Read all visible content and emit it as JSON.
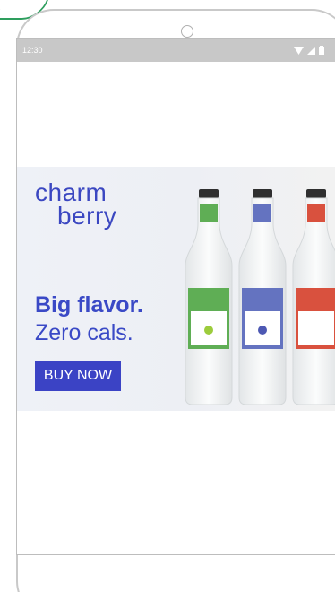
{
  "status_bar": {
    "time": "12:30"
  },
  "ad": {
    "brand_line1": "charm",
    "brand_line2": "berry",
    "headline": "Big flavor.",
    "subline": "Zero cals.",
    "cta_label": "BUY NOW"
  },
  "colors": {
    "brand_blue": "#3a49c6",
    "button_blue": "#3b43c5",
    "status_bar_gray": "#c8c8c8",
    "green_label": "#5fae55",
    "blue_label": "#6473c0",
    "red_label": "#d9513e"
  },
  "icons": [
    "camera-icon",
    "wifi-icon",
    "signal-icon",
    "battery-icon"
  ]
}
